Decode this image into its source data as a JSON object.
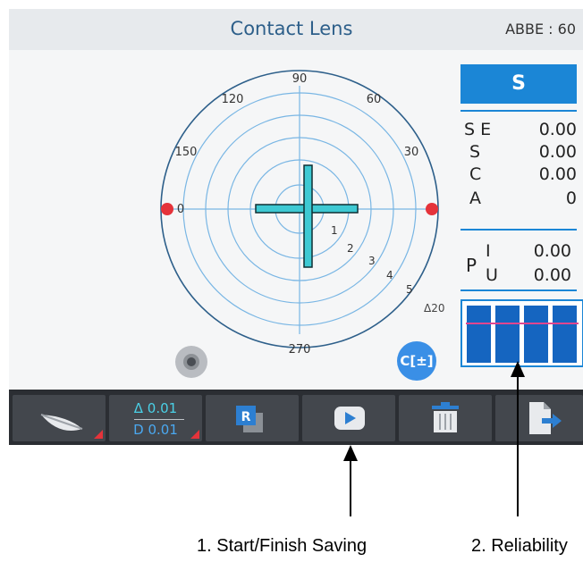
{
  "title": "Contact Lens",
  "abbe": "ABBE : 60",
  "polar": {
    "angles": [
      "90",
      "60",
      "30",
      "0",
      "150",
      "120"
    ],
    "rings": [
      "1",
      "2",
      "3",
      "4",
      "5"
    ],
    "bottom": "270",
    "delta": "Δ20"
  },
  "readout": {
    "header": "S",
    "rows": [
      {
        "label": "S E",
        "value": "0.00"
      },
      {
        "label": "S",
        "value": "0.00"
      },
      {
        "label": "C",
        "value": "0.00"
      },
      {
        "label": "A",
        "value": "0"
      }
    ],
    "p_label": "P",
    "p_rows": [
      {
        "label": "I",
        "value": "0.00"
      },
      {
        "label": "U",
        "value": "0.00"
      }
    ]
  },
  "reliability_bars": 4,
  "cyl_button": "C[±]",
  "toolbar": {
    "step_delta": "Δ 0.01",
    "step_d": "D 0.01",
    "record_label": "R"
  },
  "captions": {
    "start_finish": "1. Start/Finish Saving",
    "reliability": "2. Reliability"
  },
  "colors": {
    "accent": "#1b86d6",
    "cross": "#3ec9d3",
    "marker": "#e5333a"
  }
}
